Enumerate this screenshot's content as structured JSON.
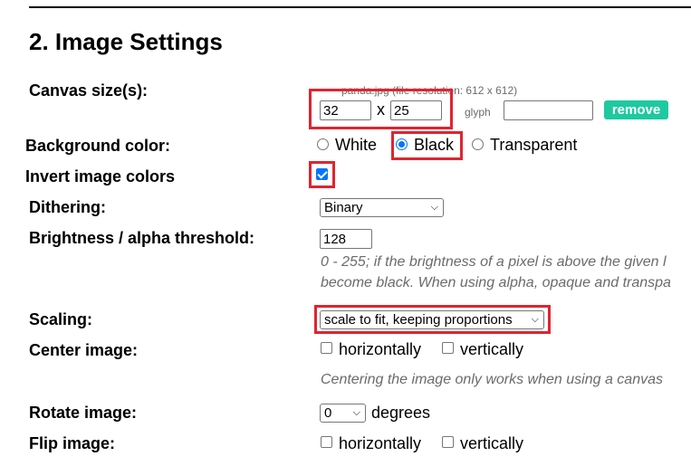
{
  "section": {
    "title": "2. Image Settings"
  },
  "canvas": {
    "label": "Canvas size(s):",
    "file_info": "panda.jpg (file resolution: 612 x 612)",
    "width": "32",
    "separator": "x",
    "height": "25",
    "glyph_label": "glyph",
    "glyph_value": "",
    "remove_label": "remove"
  },
  "background": {
    "label": "Background color:",
    "options": [
      "White",
      "Black",
      "Transparent"
    ],
    "selected": "Black"
  },
  "invert": {
    "label": "Invert image colors",
    "checked": true
  },
  "dithering": {
    "label": "Dithering:",
    "value": "Binary"
  },
  "brightness": {
    "label": "Brightness / alpha threshold:",
    "value": "128",
    "hint_line1": "0 - 255; if the brightness of a pixel is above the given l",
    "hint_line2": "become black. When using alpha, opaque and transpa"
  },
  "scaling": {
    "label": "Scaling:",
    "value": "scale to fit, keeping proportions"
  },
  "center": {
    "label": "Center image:",
    "horizontal_label": "horizontally",
    "vertical_label": "vertically",
    "hint": "Centering the image only works when using a canvas"
  },
  "rotate": {
    "label": "Rotate image:",
    "value": "0",
    "unit": "degrees"
  },
  "flip": {
    "label": "Flip image:",
    "horizontal_label": "horizontally",
    "vertical_label": "vertically"
  },
  "colors": {
    "highlight": "#e0242f",
    "accent": "#0075ff",
    "remove_button": "#1ec9a0"
  }
}
